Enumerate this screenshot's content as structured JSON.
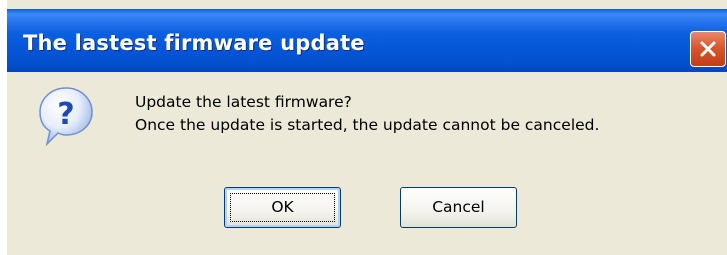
{
  "window": {
    "title": "The lastest firmware update",
    "close_icon": "close-icon"
  },
  "dialog": {
    "icon": "question-icon",
    "message_line1": "Update the latest firmware?",
    "message_line2": "Once the update is started, the update cannot be canceled."
  },
  "buttons": {
    "ok_label": "OK",
    "cancel_label": "Cancel"
  },
  "colors": {
    "titlebar": "#0554d6",
    "close_button": "#d9572f",
    "dialog_background": "#ece9d8",
    "button_border": "#003c74"
  }
}
